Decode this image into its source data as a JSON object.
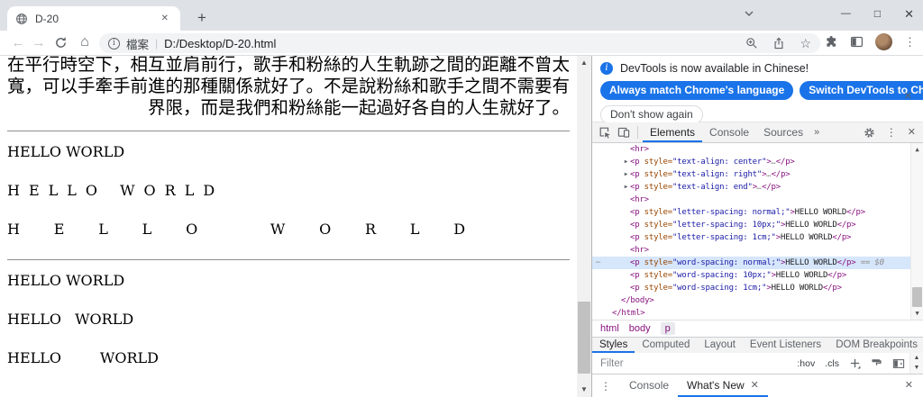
{
  "window": {
    "tab_title": "D-20",
    "new_tab_label": "+",
    "controls": {
      "tab_search": "⌄",
      "minimize": "—",
      "maximize": "□",
      "close": "✕"
    }
  },
  "toolbar": {
    "back": "←",
    "forward": "→",
    "home": "⌂",
    "address": {
      "file_label": "檔案",
      "separator": "|",
      "url": "D:/Desktop/D-20.html"
    },
    "star": "☆",
    "menu": "⋮"
  },
  "page": {
    "paragraph": {
      "lines": [
        "在平行時空下，相互並肩前行，歌手和粉絲的人生軌跡之間的距離不曾太",
        "寬，可以手牽手前進的那種關係就好了。不是說粉絲和歌手之間不需要有",
        "界限，而是我們和粉絲能一起過好各自的人生就好了。"
      ]
    },
    "letter_spacing": [
      {
        "style": "letter-spacing: normal",
        "text": "HELLO WORLD"
      },
      {
        "style": "letter-spacing: 10px",
        "text": "HELLO WORLD"
      },
      {
        "style": "letter-spacing: 1cm",
        "text": "HELLO WORLD"
      }
    ],
    "word_spacing": [
      {
        "style": "word-spacing: normal",
        "text": "HELLO WORLD"
      },
      {
        "style": "word-spacing: 10px",
        "text": "HELLO WORLD"
      },
      {
        "style": "word-spacing: 1cm",
        "text": "HELLO WORLD"
      }
    ]
  },
  "devtools": {
    "notification": {
      "message": "DevTools is now available in Chinese!",
      "primary_button": "Always match Chrome's language",
      "secondary_button": "Switch DevTools to Chinese",
      "dismiss_button": "Don't show again",
      "close": "✕"
    },
    "tabs": {
      "items": [
        "Elements",
        "Console",
        "Sources"
      ],
      "active": "Elements",
      "more": "»",
      "menu": "⋮",
      "close": "✕"
    },
    "elements_tree": {
      "expander_glyph": "▶",
      "rows": [
        {
          "indent": 2,
          "tokens": [
            [
              "t",
              "<hr>"
            ]
          ]
        },
        {
          "indent": 2,
          "expand": true,
          "tokens": [
            [
              "t",
              "<p"
            ],
            [
              "a",
              " style="
            ],
            [
              "v",
              "\"text-align: center\""
            ],
            [
              "t",
              ">"
            ],
            [
              "d",
              "…"
            ],
            [
              "t",
              "</p>"
            ]
          ]
        },
        {
          "indent": 2,
          "expand": true,
          "tokens": [
            [
              "t",
              "<p"
            ],
            [
              "a",
              " style="
            ],
            [
              "v",
              "\"text-align: right\""
            ],
            [
              "t",
              ">"
            ],
            [
              "d",
              "…"
            ],
            [
              "t",
              "</p>"
            ]
          ]
        },
        {
          "indent": 2,
          "expand": true,
          "tokens": [
            [
              "t",
              "<p"
            ],
            [
              "a",
              " style="
            ],
            [
              "v",
              "\"text-align: end\""
            ],
            [
              "t",
              ">"
            ],
            [
              "d",
              "…"
            ],
            [
              "t",
              "</p>"
            ]
          ]
        },
        {
          "indent": 2,
          "tokens": [
            [
              "t",
              "<hr>"
            ]
          ]
        },
        {
          "indent": 2,
          "tokens": [
            [
              "t",
              "<p"
            ],
            [
              "a",
              " style="
            ],
            [
              "v",
              "\"letter-spacing: normal;\""
            ],
            [
              "t",
              ">"
            ],
            [
              "x",
              "HELLO WORLD"
            ],
            [
              "t",
              "</p>"
            ]
          ]
        },
        {
          "indent": 2,
          "tokens": [
            [
              "t",
              "<p"
            ],
            [
              "a",
              " style="
            ],
            [
              "v",
              "\"letter-spacing: 10px;\""
            ],
            [
              "t",
              ">"
            ],
            [
              "x",
              "HELLO WORLD"
            ],
            [
              "t",
              "</p>"
            ]
          ]
        },
        {
          "indent": 2,
          "tokens": [
            [
              "t",
              "<p"
            ],
            [
              "a",
              " style="
            ],
            [
              "v",
              "\"letter-spacing: 1cm;\""
            ],
            [
              "t",
              ">"
            ],
            [
              "x",
              "HELLO WORLD"
            ],
            [
              "t",
              "</p>"
            ]
          ]
        },
        {
          "indent": 2,
          "tokens": [
            [
              "t",
              "<hr>"
            ]
          ]
        },
        {
          "indent": 2,
          "selected": true,
          "gutter": "⋯",
          "tokens": [
            [
              "t",
              "<p"
            ],
            [
              "a",
              " style="
            ],
            [
              "v",
              "\"word-spacing: normal;\""
            ],
            [
              "t",
              ">"
            ],
            [
              "x",
              "HELLO WORLD"
            ],
            [
              "t",
              "</p>"
            ],
            [
              "d",
              " == $0"
            ]
          ]
        },
        {
          "indent": 2,
          "tokens": [
            [
              "t",
              "<p"
            ],
            [
              "a",
              " style="
            ],
            [
              "v",
              "\"word-spacing: 10px;\""
            ],
            [
              "t",
              ">"
            ],
            [
              "x",
              "HELLO WORLD"
            ],
            [
              "t",
              "</p>"
            ]
          ]
        },
        {
          "indent": 2,
          "tokens": [
            [
              "t",
              "<p"
            ],
            [
              "a",
              " style="
            ],
            [
              "v",
              "\"word-spacing: 1cm;\""
            ],
            [
              "t",
              ">"
            ],
            [
              "x",
              "HELLO WORLD"
            ],
            [
              "t",
              "</p>"
            ]
          ]
        },
        {
          "indent": 1,
          "tokens": [
            [
              "t",
              "</body>"
            ]
          ]
        },
        {
          "indent": 0,
          "tokens": [
            [
              "t",
              "</html>"
            ]
          ]
        }
      ]
    },
    "breadcrumb": {
      "items": [
        "html",
        "body",
        "p"
      ],
      "selected": "p"
    },
    "sidebar_tabs": {
      "items": [
        "Styles",
        "Computed",
        "Layout",
        "Event Listeners",
        "DOM Breakpoints"
      ],
      "active": "Styles",
      "more": "»"
    },
    "styles_toolbar": {
      "filter_placeholder": "Filter",
      "hov": ":hov",
      "cls": ".cls"
    },
    "drawer": {
      "menu": "⋮",
      "tabs": [
        "Console",
        "What's New"
      ],
      "active": "What's New",
      "tab_close": "✕",
      "close": "✕"
    }
  },
  "icons": {
    "scroll_up": "▲",
    "scroll_down": "▼"
  },
  "colors": {
    "accent": "#1a73e8",
    "tag": "#881280",
    "attr_name": "#994500",
    "attr_value": "#1a1aa6",
    "selected_row": "#d6e6fb",
    "tabbar_bg": "#dee1e6"
  }
}
